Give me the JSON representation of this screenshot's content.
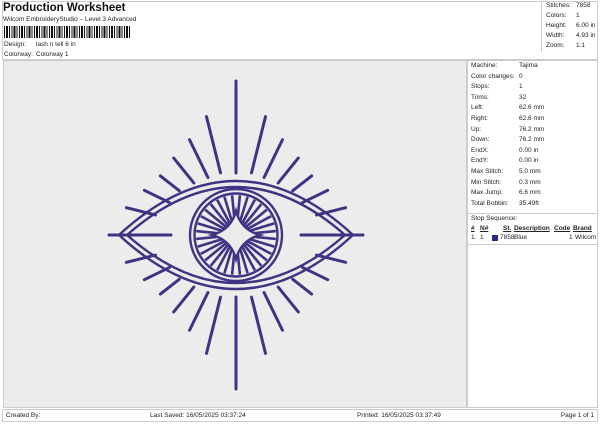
{
  "header": {
    "title": "Production Worksheet",
    "subtitle": "Wilcom EmbroideryStudio – Level 3 Advanced",
    "design_label": "Design:",
    "design_value": "lash n tell 6 in",
    "colorway_label": "Colorway:",
    "colorway_value": "Colorway 1"
  },
  "summary": [
    {
      "label": "Stitches:",
      "value": "7858"
    },
    {
      "label": "Colors:",
      "value": "1"
    },
    {
      "label": "Height:",
      "value": "6.00 in"
    },
    {
      "label": "Width:",
      "value": "4.93 in"
    },
    {
      "label": "Zoom:",
      "value": "1:1"
    }
  ],
  "details": [
    {
      "label": "Machine:",
      "value": "Tajima"
    },
    {
      "label": "Color changes:",
      "value": "0"
    },
    {
      "label": "Stops:",
      "value": "1"
    },
    {
      "label": "Trims:",
      "value": "32"
    },
    {
      "label": "Left:",
      "value": "62.6 mm"
    },
    {
      "label": "Right:",
      "value": "62.6 mm"
    },
    {
      "label": "Up:",
      "value": "76.2 mm"
    },
    {
      "label": "Down:",
      "value": "76.2 mm"
    },
    {
      "label": "EndX:",
      "value": "0.00 in"
    },
    {
      "label": "EndY:",
      "value": "0.00 in"
    },
    {
      "label": "Max Stitch:",
      "value": "5.0 mm"
    },
    {
      "label": "Min Stitch:",
      "value": "0.3 mm"
    },
    {
      "label": "Max Jump:",
      "value": "6.6 mm"
    },
    {
      "label": "Total Bobbin:",
      "value": "35.49ft"
    }
  ],
  "stop_sequence": {
    "title": "Stop Sequence:",
    "columns": [
      "#",
      "N#",
      "St.",
      "Description",
      "Code",
      "Brand"
    ],
    "rows": [
      {
        "num": "1.",
        "n": "1",
        "swatch": "#2a2a8a",
        "st": "7858",
        "description": "Blue",
        "code": "1",
        "brand": "Wilcom"
      }
    ]
  },
  "design": {
    "thread_color": "#3f3384"
  },
  "footer": {
    "created_by": "Created By:",
    "last_saved": "Last Saved: 16/05/2025 03:37:24",
    "printed": "Printed: 16/05/2025 03:37:49",
    "page": "Page 1 of 1"
  }
}
